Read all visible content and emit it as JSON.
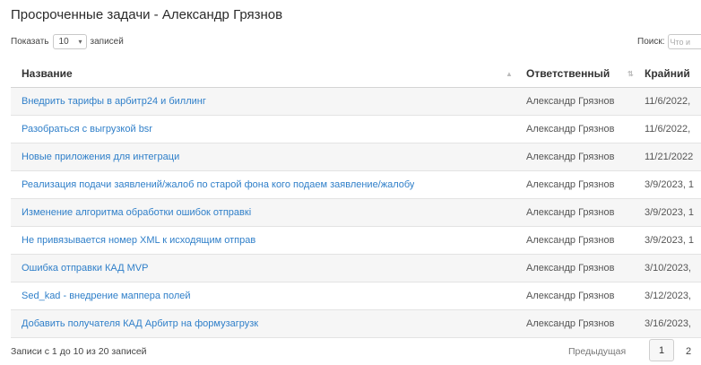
{
  "title": "Просроченные задачи - Александр Грязнов",
  "length_menu": {
    "prefix": "Показать",
    "value": "10",
    "suffix": "записей"
  },
  "search": {
    "label": "Поиск:",
    "placeholder": "Что и"
  },
  "columns": [
    "Название",
    "Ответственный",
    "Крайний"
  ],
  "rows": [
    {
      "name": "Внедрить тарифы в арбитр24 и биллинг",
      "owner": "Александр Грязнов",
      "deadline": "11/6/2022,"
    },
    {
      "name": "Разобраться с выгрузкой bsr",
      "owner": "Александр Грязнов",
      "deadline": "11/6/2022,"
    },
    {
      "name": "Новые приложения для интеграци",
      "owner": "Александр Грязнов",
      "deadline": "11/21/2022"
    },
    {
      "name": "Реализация подачи заявлений/жалоб по старой фона кого подаем заявление/жалобу",
      "owner": "Александр Грязнов",
      "deadline": "3/9/2023, 1"
    },
    {
      "name": "Изменение алгоритма обработки ошибок отправкі",
      "owner": "Александр Грязнов",
      "deadline": "3/9/2023, 1"
    },
    {
      "name": "Не привязывается номер XML к исходящим отправ",
      "owner": "Александр Грязнов",
      "deadline": "3/9/2023, 1"
    },
    {
      "name": "Ошибка отправки КАД MVP",
      "owner": "Александр Грязнов",
      "deadline": "3/10/2023,"
    },
    {
      "name": "Sed_kad - внедрение маппера полей",
      "owner": "Александр Грязнов",
      "deadline": "3/12/2023,"
    },
    {
      "name": "Добавить получателя КАД Арбитр на формузагрузк",
      "owner": "Александр Грязнов",
      "deadline": "3/16/2023,"
    }
  ],
  "footer": {
    "info": "Записи с 1 до 10 из 20 записей",
    "prev": "Предыдущая",
    "pages": [
      "1",
      "2"
    ]
  }
}
